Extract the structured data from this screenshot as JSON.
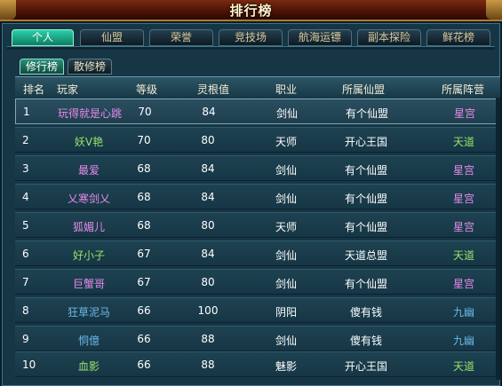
{
  "window": {
    "title": "排行榜"
  },
  "tabs": [
    {
      "label": "个人",
      "active": true
    },
    {
      "label": "仙盟",
      "active": false
    },
    {
      "label": "荣誉",
      "active": false
    },
    {
      "label": "竞技场",
      "active": false
    },
    {
      "label": "航海运镖",
      "active": false
    },
    {
      "label": "副本探险",
      "active": false
    },
    {
      "label": "鲜花榜",
      "active": false
    }
  ],
  "subtabs": [
    {
      "label": "修行榜",
      "active": true
    },
    {
      "label": "散修榜",
      "active": false
    }
  ],
  "table": {
    "headers": [
      "排名",
      "玩家",
      "等级",
      "灵根值",
      "职业",
      "所属仙盟",
      "所属阵营"
    ],
    "rows": [
      {
        "rank": "1",
        "name": "玩得就是心跳",
        "level": "70",
        "root": "84",
        "job": "剑仙",
        "guild": "有个仙盟",
        "camp": "星宫"
      },
      {
        "rank": "2",
        "name": "妖V艳",
        "level": "70",
        "root": "80",
        "job": "天师",
        "guild": "开心王国",
        "camp": "天道"
      },
      {
        "rank": "3",
        "name": "最爱",
        "level": "68",
        "root": "84",
        "job": "剑仙",
        "guild": "有个仙盟",
        "camp": "星宫"
      },
      {
        "rank": "4",
        "name": "乂寒剑乂",
        "level": "68",
        "root": "84",
        "job": "剑仙",
        "guild": "有个仙盟",
        "camp": "星宫"
      },
      {
        "rank": "5",
        "name": "狐媚儿",
        "level": "68",
        "root": "80",
        "job": "天师",
        "guild": "有个仙盟",
        "camp": "星宫"
      },
      {
        "rank": "6",
        "name": "好小子",
        "level": "67",
        "root": "84",
        "job": "剑仙",
        "guild": "天道总盟",
        "camp": "天道"
      },
      {
        "rank": "7",
        "name": "巨蟹哥",
        "level": "67",
        "root": "80",
        "job": "剑仙",
        "guild": "有个仙盟",
        "camp": "星宫"
      },
      {
        "rank": "8",
        "name": "狂草泥马",
        "level": "66",
        "root": "100",
        "job": "阴阳",
        "guild": "傻有钱",
        "camp": "九幽"
      },
      {
        "rank": "9",
        "name": "恫億",
        "level": "66",
        "root": "88",
        "job": "剑仙",
        "guild": "傻有钱",
        "camp": "九幽"
      },
      {
        "rank": "10",
        "name": "血影",
        "level": "66",
        "root": "88",
        "job": "魅影",
        "guild": "开心王国",
        "camp": "天道"
      }
    ]
  },
  "colors": {
    "camp_xinggong": "#e58ae9",
    "camp_tiandao": "#97e36a",
    "camp_jiuyou": "#6ab8ea"
  }
}
